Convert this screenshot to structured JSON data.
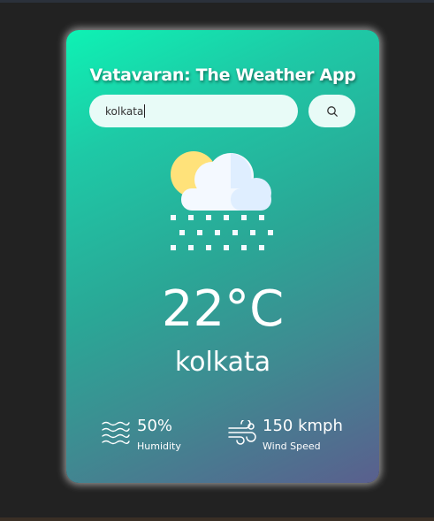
{
  "app": {
    "title": "Vatavaran: The Weather App"
  },
  "search": {
    "value": "kolkata",
    "placeholder": ""
  },
  "weather": {
    "icon": "snow-icon",
    "temperature": "22°C",
    "city": "kolkata"
  },
  "details": {
    "humidity": {
      "value": "50%",
      "label": "Humidity",
      "icon": "humidity-icon"
    },
    "wind": {
      "value": "150 kmph",
      "label": "Wind Speed",
      "icon": "wind-icon"
    }
  },
  "colors": {
    "background": "#222222",
    "card_gradient_start": "#0ef2b4",
    "card_gradient_end": "#5a5f8e",
    "input_bg": "#e8fbf7",
    "text": "#ffffff"
  }
}
